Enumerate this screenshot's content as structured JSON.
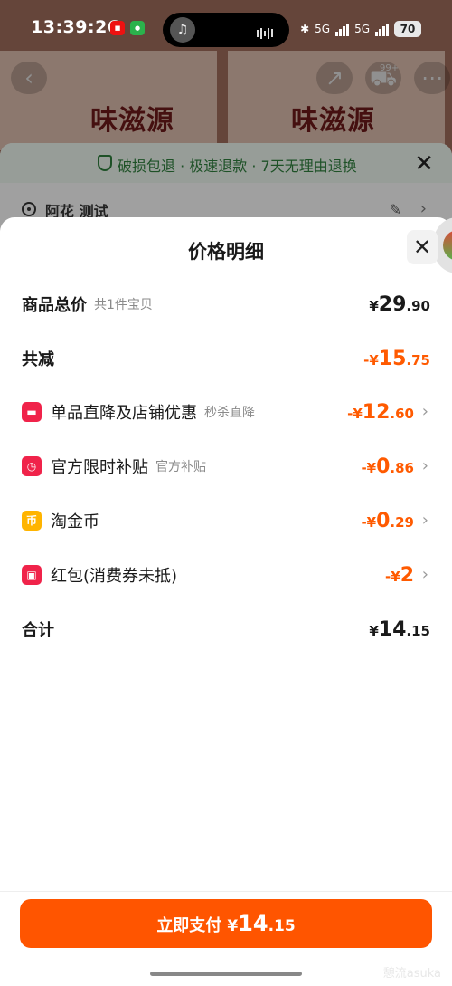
{
  "status_bar": {
    "time": "13:39:26",
    "network_1": "5G",
    "network_2": "5G",
    "battery": "70"
  },
  "background": {
    "brand_left": "味滋源",
    "brand_right": "味滋源",
    "cart_count": "99+",
    "delivery_sheet": {
      "guarantee_text": "破损包退 · 极速退款 · 7天无理由退换",
      "address": "阿花 测试"
    }
  },
  "price_detail": {
    "title": "价格明细",
    "rows": [
      {
        "label": "商品总价",
        "sublabel": "共1件宝贝",
        "currency": "¥",
        "int": "29",
        "dec": ".90"
      },
      {
        "label": "共减",
        "currency": "-¥",
        "int": "15",
        "dec": ".75"
      },
      {
        "label": "单品直降及店铺优惠",
        "sublabel": "秒杀直降",
        "currency": "-¥",
        "int": "12",
        "dec": ".60",
        "icon": "store-discount-icon"
      },
      {
        "label": "官方限时补贴",
        "sublabel": "官方补贴",
        "currency": "-¥",
        "int": "0",
        "dec": ".86",
        "icon": "clock-subsidy-icon"
      },
      {
        "label": "淘金币",
        "currency": "-¥",
        "int": "0",
        "dec": ".29",
        "icon": "coin-icon",
        "icon_glyph": "币"
      },
      {
        "label": "红包(消费券未抵)",
        "currency": "-¥",
        "int": "2",
        "dec": "",
        "icon": "red-packet-icon"
      },
      {
        "label": "合计",
        "currency": "¥",
        "int": "14",
        "dec": ".15"
      }
    ]
  },
  "pay_button": {
    "label": "立即支付",
    "currency": "¥",
    "int": "14",
    "dec": ".15"
  },
  "watermark": "憩流asuka",
  "colors": {
    "accent_orange": "#ff5500",
    "discount_text": "#ff5a00",
    "icon_red": "#f0234a",
    "icon_yellow": "#ffb400"
  }
}
